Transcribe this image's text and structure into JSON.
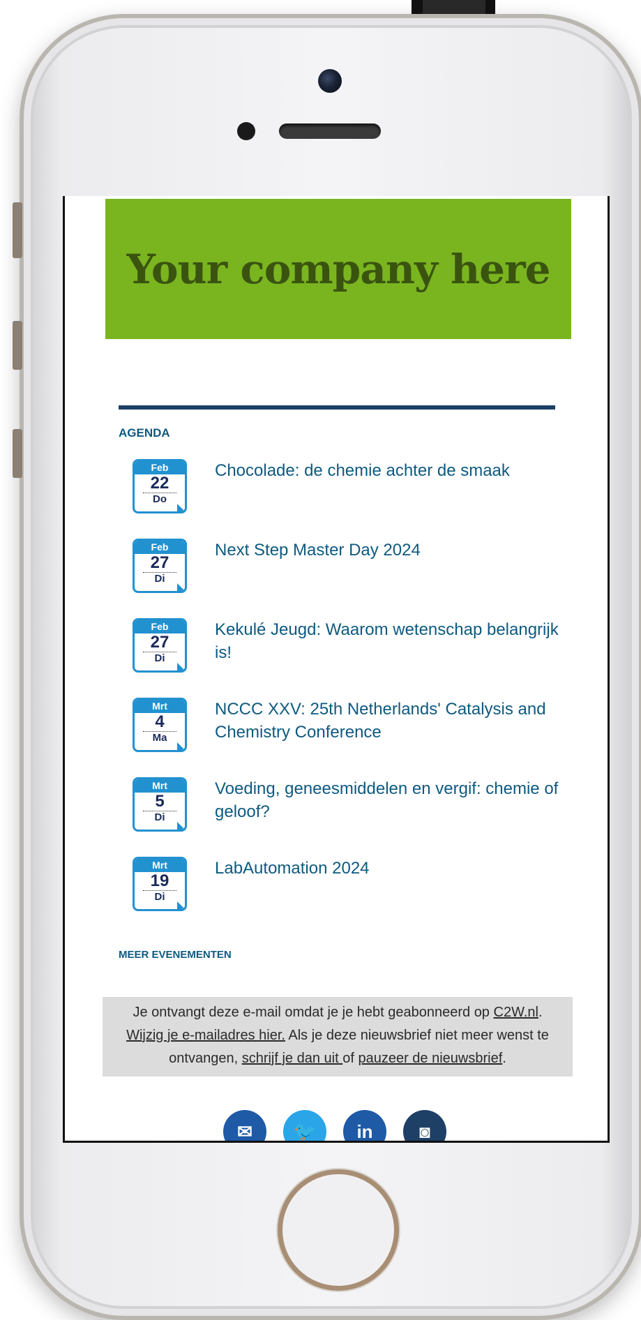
{
  "banner": {
    "text": "Your company here"
  },
  "agenda": {
    "title": "AGENDA",
    "events": [
      {
        "month": "Feb",
        "day": "22",
        "weekday": "Do",
        "title": "Chocolade: de chemie achter de smaak"
      },
      {
        "month": "Feb",
        "day": "27",
        "weekday": "Di",
        "title": "Next Step Master Day 2024"
      },
      {
        "month": "Feb",
        "day": "27",
        "weekday": "Di",
        "title": "Kekulé Jeugd: Waarom wetenschap belangrijk is!"
      },
      {
        "month": "Mrt",
        "day": "4",
        "weekday": "Ma",
        "title": "NCCC XXV: 25th Netherlands' Catalysis and Chemistry Conference"
      },
      {
        "month": "Mrt",
        "day": "5",
        "weekday": "Di",
        "title": "Voeding, geneesmiddelen en vergif: chemie of geloof?"
      },
      {
        "month": "Mrt",
        "day": "19",
        "weekday": "Di",
        "title": "LabAutomation 2024"
      }
    ],
    "more_label": "MEER EVENEMENTEN"
  },
  "notice": {
    "t1": "Je ontvangt deze e-mail omdat je je hebt geabonneerd op ",
    "link_site": "C2W.nl",
    "t2": ".",
    "link_change": "Wijzig je e-mailadres hier.",
    "t3": " Als je deze nieuwsbrief niet meer wenst te ontvangen, ",
    "link_unsub": "schrijf je dan uit ",
    "t4": "of ",
    "link_pause": "pauzeer de nieuwsbrief",
    "t5": "."
  },
  "social": [
    {
      "icon": "mail-icon",
      "glyph": "✉",
      "color": "#1e5aa6"
    },
    {
      "icon": "twitter-icon",
      "glyph": "🐦",
      "color": "#2aa6e8"
    },
    {
      "icon": "linkedin-icon",
      "glyph": "in",
      "color": "#1e5aa6"
    },
    {
      "icon": "instagram-icon",
      "glyph": "◙",
      "color": "#1e3f66"
    }
  ]
}
